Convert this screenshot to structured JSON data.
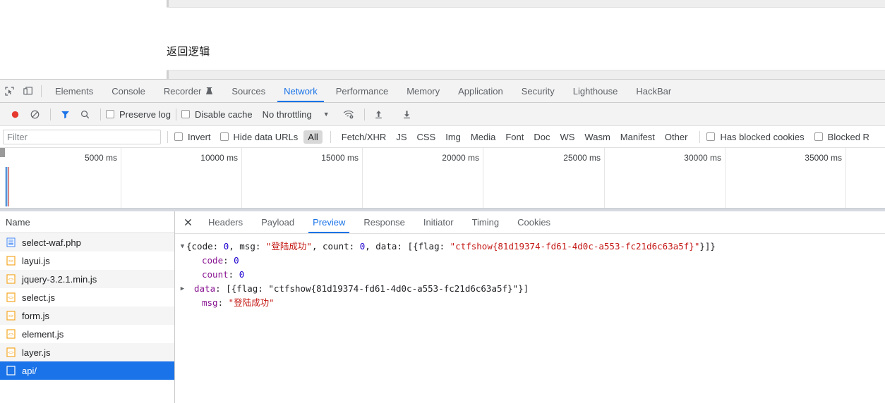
{
  "page": {
    "text": "返回逻辑"
  },
  "devtools": {
    "icons": {
      "inspect": "inspect-cursor-icon",
      "device": "device-toolbar-icon"
    },
    "main_tabs": [
      {
        "label": "Elements",
        "active": false
      },
      {
        "label": "Console",
        "active": false
      },
      {
        "label": "Recorder",
        "active": false,
        "icon": "experiment-flask-icon"
      },
      {
        "label": "Sources",
        "active": false
      },
      {
        "label": "Network",
        "active": true
      },
      {
        "label": "Performance",
        "active": false
      },
      {
        "label": "Memory",
        "active": false
      },
      {
        "label": "Application",
        "active": false
      },
      {
        "label": "Security",
        "active": false
      },
      {
        "label": "Lighthouse",
        "active": false
      },
      {
        "label": "HackBar",
        "active": false
      }
    ],
    "accent_color": "#1a73e8",
    "record_color": "#e5392f"
  },
  "network_toolbar": {
    "record_icon": "record-circle-icon",
    "clear_icon": "clear-no-entry-icon",
    "filter_icon": "funnel-filter-icon",
    "search_icon": "search-magnifier-icon",
    "preserve_log_label": "Preserve log",
    "preserve_log_checked": false,
    "disable_cache_label": "Disable cache",
    "disable_cache_checked": false,
    "throttling_label": "No throttling",
    "throttling_caret": "▼",
    "wifi_icon": "network-conditions-wifi-icon",
    "import_icon": "import-har-up-arrow-icon",
    "export_icon": "export-har-down-arrow-icon"
  },
  "filter_bar": {
    "filter_placeholder": "Filter",
    "filter_value": "",
    "invert_label": "Invert",
    "invert_checked": false,
    "hide_data_urls_label": "Hide data URLs",
    "hide_data_urls_checked": false,
    "types": [
      {
        "label": "All",
        "selected": true
      },
      {
        "label": "Fetch/XHR",
        "selected": false
      },
      {
        "label": "JS",
        "selected": false
      },
      {
        "label": "CSS",
        "selected": false
      },
      {
        "label": "Img",
        "selected": false
      },
      {
        "label": "Media",
        "selected": false
      },
      {
        "label": "Font",
        "selected": false
      },
      {
        "label": "Doc",
        "selected": false
      },
      {
        "label": "WS",
        "selected": false
      },
      {
        "label": "Wasm",
        "selected": false
      },
      {
        "label": "Manifest",
        "selected": false
      },
      {
        "label": "Other",
        "selected": false
      }
    ],
    "has_blocked_cookies_label": "Has blocked cookies",
    "has_blocked_cookies_checked": false,
    "blocked_requests_label": "Blocked R",
    "blocked_requests_checked": false
  },
  "overview": {
    "ticks": [
      "5000 ms",
      "10000 ms",
      "15000 ms",
      "20000 ms",
      "25000 ms",
      "30000 ms",
      "35000 ms"
    ],
    "request_bar_color": "#a7c8e8",
    "dom_content_loaded_color": "#3b7fd4",
    "load_event_color": "#b72323"
  },
  "request_list": {
    "column_header": "Name",
    "rows": [
      {
        "name": "select-waf.php",
        "icon": "document-page-icon",
        "selected": false
      },
      {
        "name": "layui.js",
        "icon": "script-js-icon",
        "selected": false
      },
      {
        "name": "jquery-3.2.1.min.js",
        "icon": "script-js-icon",
        "selected": false
      },
      {
        "name": "select.js",
        "icon": "script-js-icon",
        "selected": false
      },
      {
        "name": "form.js",
        "icon": "script-js-icon",
        "selected": false
      },
      {
        "name": "element.js",
        "icon": "script-js-icon",
        "selected": false
      },
      {
        "name": "layer.js",
        "icon": "script-js-icon",
        "selected": false
      },
      {
        "name": "api/",
        "icon": "generic-file-icon",
        "selected": true
      }
    ]
  },
  "detail": {
    "close_icon": "close-x-icon",
    "tabs": [
      {
        "label": "Headers",
        "active": false
      },
      {
        "label": "Payload",
        "active": false
      },
      {
        "label": "Preview",
        "active": true
      },
      {
        "label": "Response",
        "active": false
      },
      {
        "label": "Initiator",
        "active": false
      },
      {
        "label": "Timing",
        "active": false
      },
      {
        "label": "Cookies",
        "active": false
      }
    ],
    "preview": {
      "root": {
        "triangle": "▼",
        "summary_prefix": "{code: ",
        "code": "0",
        "mid1": ", msg: ",
        "msg_quoted": "\"登陆成功\"",
        "mid2": ", count: ",
        "count": "0",
        "mid3": ", data: [{flag: ",
        "flag_quoted": "\"ctfshow{81d19374-fd61-4d0c-a553-fc21d6c63a5f}\"",
        "suffix": "}]}"
      },
      "rows": [
        {
          "triangle": "",
          "key": "code",
          "value": "0",
          "value_kind": "number"
        },
        {
          "triangle": "",
          "key": "count",
          "value": "0",
          "value_kind": "number"
        },
        {
          "triangle": "▶",
          "key": "data",
          "value": "[{flag: \"ctfshow{81d19374-fd61-4d0c-a553-fc21d6c63a5f}\"}]",
          "value_kind": "plain"
        },
        {
          "triangle": "",
          "key": "msg",
          "value": "\"登陆成功\"",
          "value_kind": "string"
        }
      ]
    }
  }
}
